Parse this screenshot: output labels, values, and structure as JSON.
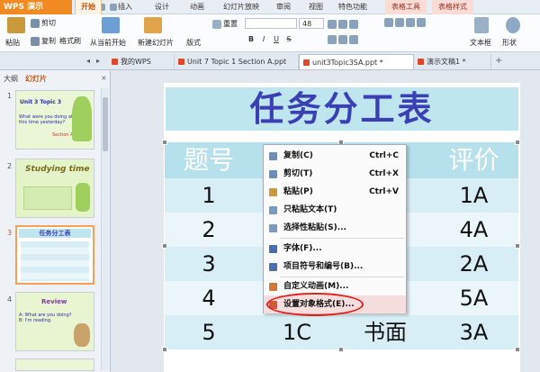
{
  "app": {
    "name": "WPS 演示"
  },
  "menu": {
    "tabs": [
      "开始",
      "插入",
      "设计",
      "动画",
      "幻灯片放映",
      "审阅",
      "视图",
      "特色功能",
      "表格工具",
      "表格样式"
    ],
    "active": "开始"
  },
  "ribbon": {
    "cut": "剪切",
    "paste": "粘贴",
    "copy": "复制",
    "format_painter": "格式刷",
    "from_current": "从当前开始",
    "new_slide": "新建幻灯片",
    "layout": "版式",
    "reset": "重置",
    "font_size": "48",
    "format_buttons": [
      "B",
      "I",
      "U",
      "S"
    ],
    "textbox": "文本框",
    "shape": "形状"
  },
  "doc_tabs": [
    "我的WPS",
    "Unit 7 Topic 1 Section A.ppt",
    "unit3Topic3SA.ppt *",
    "演示文稿1 *"
  ],
  "left_pane": {
    "tabs": [
      "大纲",
      "幻灯片"
    ],
    "active": "幻灯片",
    "slides": [
      {
        "num": "1",
        "title": "Unit 3 Topic 3",
        "text": "What were you doing at this time yesterday?",
        "sub": "Section A"
      },
      {
        "num": "2",
        "title": "Studying time",
        "text": ""
      },
      {
        "num": "3",
        "title": "任务分工表",
        "text": ""
      },
      {
        "num": "4",
        "title": "Review",
        "text": "A: What are you doing?  B: I'm reading."
      }
    ]
  },
  "slide": {
    "title": "任务分工表",
    "headers": [
      "题号",
      "",
      "",
      "评价"
    ],
    "rows": [
      [
        "1",
        "",
        "",
        "1A"
      ],
      [
        "2",
        "",
        "",
        "4A"
      ],
      [
        "3",
        "",
        "",
        "2A"
      ],
      [
        "4",
        "",
        "",
        "5A"
      ],
      [
        "5",
        "1C",
        "书面",
        "3A"
      ]
    ]
  },
  "context_menu": {
    "items": [
      {
        "label": "复制(C)",
        "shortcut": "Ctrl+C",
        "icon": "copy-icon",
        "color": "#6b8fb8"
      },
      {
        "label": "剪切(T)",
        "shortcut": "Ctrl+X",
        "icon": "scissors-icon",
        "color": "#6b8fb8"
      },
      {
        "label": "粘贴(P)",
        "shortcut": "Ctrl+V",
        "icon": "clipboard-icon",
        "color": "#c99a3c"
      },
      {
        "label": "只粘贴文本(T)",
        "shortcut": "",
        "icon": "paste-text-icon",
        "color": "#7a9ac0"
      },
      {
        "label": "选择性粘贴(S)...",
        "shortcut": "",
        "icon": "paste-special-icon",
        "color": "#7a9ac0"
      },
      {
        "label": "字体(F)...",
        "shortcut": "",
        "icon": "font-icon",
        "color": "#4a6fa8"
      },
      {
        "label": "项目符号和编号(B)...",
        "shortcut": "",
        "icon": "bullets-icon",
        "color": "#4a6fa8"
      },
      {
        "label": "自定义动画(M)...",
        "shortcut": "",
        "icon": "animation-icon",
        "color": "#d07a3a"
      },
      {
        "label": "设置对象格式(E)...",
        "shortcut": "",
        "icon": "format-object-icon",
        "color": "#d05a3a"
      }
    ]
  },
  "colors": {
    "accent": "#f28a24",
    "title_text": "#3b3fb4",
    "title_bg": "#bfe5ef",
    "table_header": "#b6e0ec",
    "table_row_a": "#d7eef5",
    "table_row_b": "#eaf6fa",
    "highlight": "#e0201a"
  }
}
